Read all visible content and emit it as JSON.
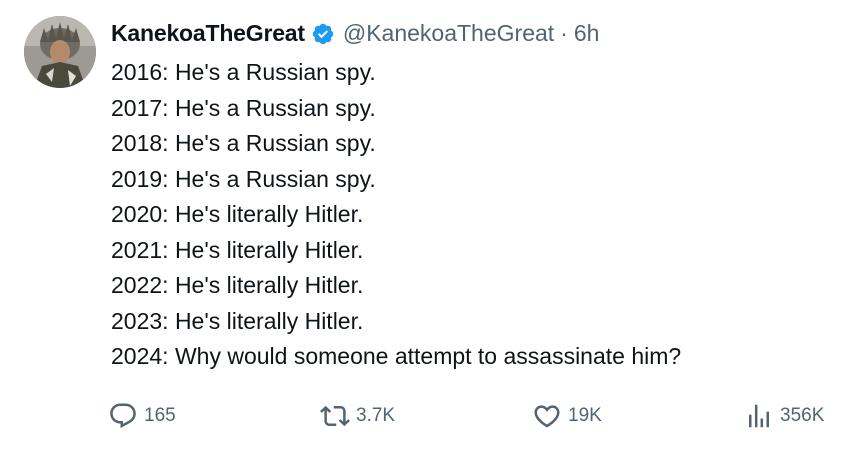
{
  "tweet": {
    "author": {
      "display_name": "KanekoaTheGreat",
      "handle": "@KanekoaTheGreat",
      "verified_icon": "verified-badge-icon",
      "avatar_icon": "avatar-image"
    },
    "separator": "·",
    "time": "6h",
    "lines": [
      "2016: He's a Russian spy.",
      "2017: He's a Russian spy.",
      "2018: He's a Russian spy.",
      "2019: He's a Russian spy.",
      "2020: He's literally Hitler.",
      "2021: He's literally Hitler.",
      "2022: He's literally Hitler.",
      "2023: He's literally Hitler.",
      "2024: Why would someone attempt to assassinate him?"
    ],
    "actions": {
      "replies": "165",
      "retweets": "3.7K",
      "likes": "19K",
      "views": "356K"
    }
  },
  "colors": {
    "text_primary": "#0f1419",
    "text_secondary": "#536471",
    "verified_blue": "#1d9bf0",
    "background": "#ffffff"
  }
}
